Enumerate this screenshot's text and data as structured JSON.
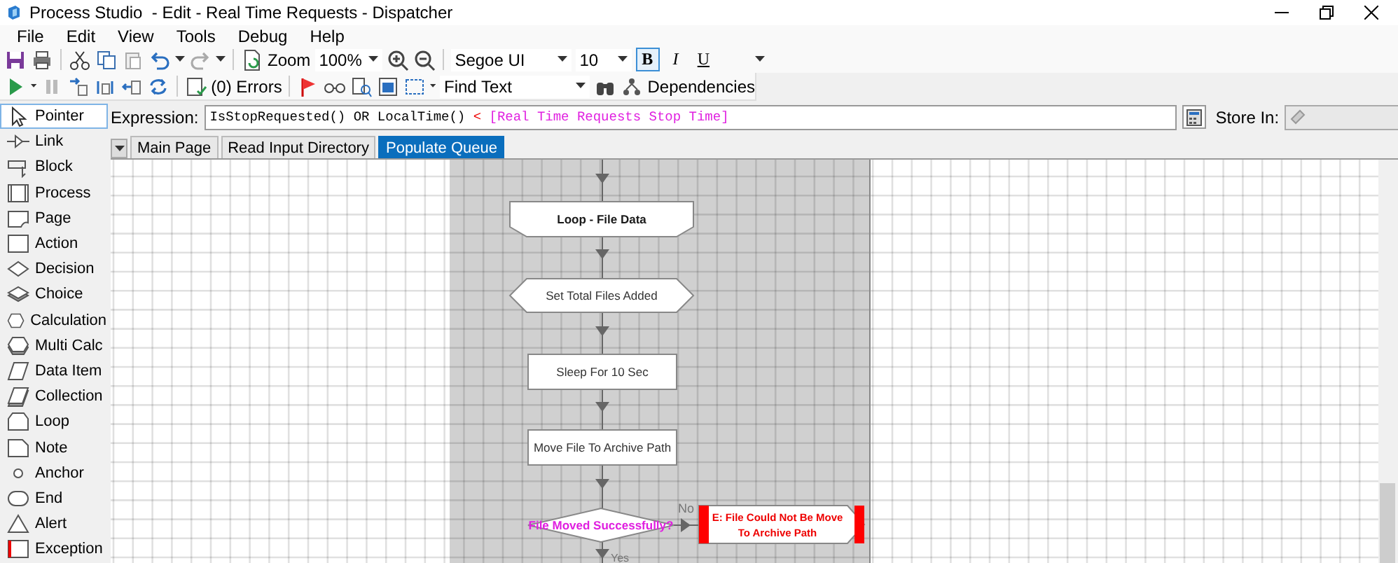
{
  "window": {
    "title": "Process Studio  - Edit - Real Time Requests - Dispatcher"
  },
  "menu": [
    "File",
    "Edit",
    "View",
    "Tools",
    "Debug",
    "Help"
  ],
  "toolbar": {
    "zoom_label": "Zoom",
    "zoom_value": "100%",
    "font": "Segoe UI",
    "size": "10",
    "bold": true,
    "italic": false,
    "underline": false,
    "bold_label": "B",
    "italic_label": "I",
    "underline_label": "U",
    "errors": "(0) Errors",
    "find_text": "Find Text",
    "dependencies": "Dependencies"
  },
  "expression": {
    "label": "Expression:",
    "segments": [
      {
        "kind": "code",
        "text": "IsStopRequested() OR LocalTime() "
      },
      {
        "kind": "operator",
        "text": "<"
      },
      {
        "kind": "reference",
        "text": " [Real Time Requests Stop Time]"
      }
    ],
    "store_label": "Store In:"
  },
  "toolbox": [
    {
      "kind": "pointer",
      "label": "Pointer",
      "selected": true
    },
    {
      "kind": "link",
      "label": "Link",
      "selected": false
    },
    {
      "kind": "block",
      "label": "Block",
      "selected": false
    },
    {
      "kind": "process",
      "label": "Process",
      "selected": false
    },
    {
      "kind": "page",
      "label": "Page",
      "selected": false
    },
    {
      "kind": "action",
      "label": "Action",
      "selected": false
    },
    {
      "kind": "decision",
      "label": "Decision",
      "selected": false
    },
    {
      "kind": "choice",
      "label": "Choice",
      "selected": false
    },
    {
      "kind": "calculation",
      "label": "Calculation",
      "selected": false
    },
    {
      "kind": "multicalc",
      "label": "Multi Calc",
      "selected": false
    },
    {
      "kind": "dataitem",
      "label": "Data Item",
      "selected": false
    },
    {
      "kind": "collection",
      "label": "Collection",
      "selected": false
    },
    {
      "kind": "loop",
      "label": "Loop",
      "selected": false
    },
    {
      "kind": "note",
      "label": "Note",
      "selected": false
    },
    {
      "kind": "anchor",
      "label": "Anchor",
      "selected": false
    },
    {
      "kind": "end",
      "label": "End",
      "selected": false
    },
    {
      "kind": "alert",
      "label": "Alert",
      "selected": false
    },
    {
      "kind": "exception",
      "label": "Exception",
      "selected": false
    }
  ],
  "tabs": [
    {
      "label": "Main Page",
      "selected": false
    },
    {
      "label": "Read Input Directory",
      "selected": false
    },
    {
      "label": "Populate Queue",
      "selected": true
    }
  ],
  "flow": {
    "nodes": [
      {
        "kind": "loop",
        "lines": [
          "Loop - File Data"
        ]
      },
      {
        "kind": "calculation",
        "lines": [
          "Set Total Files Added"
        ]
      },
      {
        "kind": "action",
        "lines": [
          "Sleep For 10 Sec"
        ]
      },
      {
        "kind": "action",
        "lines": [
          "Move File To Archive Path"
        ]
      },
      {
        "kind": "decision",
        "lines": [
          "File Moved Successfully?"
        ]
      },
      {
        "kind": "exception",
        "lines": [
          "E: File Could Not Be Move",
          "To Archive Path"
        ]
      }
    ],
    "no_label": "No",
    "yes_label": "Yes"
  }
}
